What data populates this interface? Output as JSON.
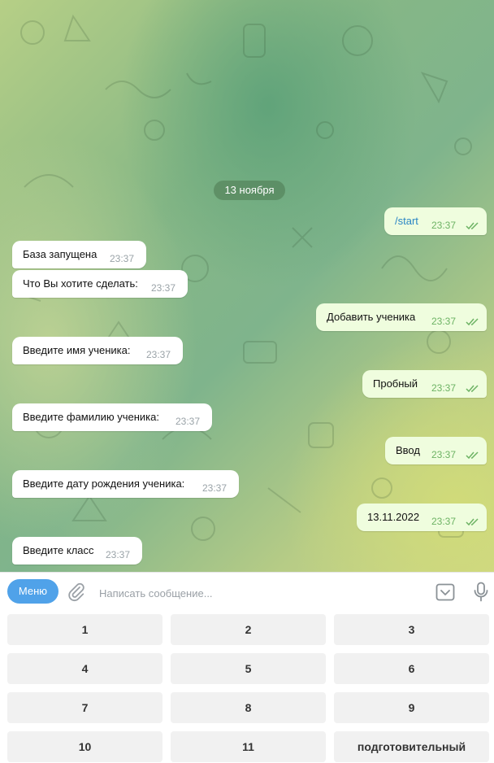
{
  "chat": {
    "date_separator": "13 ноября",
    "messages": [
      {
        "dir": "out",
        "text": "/start",
        "time": "23:37"
      },
      {
        "dir": "in",
        "text": "База запущена",
        "time": "23:37"
      },
      {
        "dir": "in",
        "text": "Что Вы хотите сделать:",
        "time": "23:37"
      },
      {
        "dir": "out",
        "text": "Добавить ученика",
        "time": "23:37"
      },
      {
        "dir": "in",
        "text": "Введите имя ученика:",
        "time": "23:37"
      },
      {
        "dir": "out",
        "text": "Пробный",
        "time": "23:37"
      },
      {
        "dir": "in",
        "text": "Введите фамилию ученика:",
        "time": "23:37"
      },
      {
        "dir": "out",
        "text": "Ввод",
        "time": "23:37"
      },
      {
        "dir": "in",
        "text": "Введите дату рождения ученика:",
        "time": "23:37"
      },
      {
        "dir": "out",
        "text": "13.11.2022",
        "time": "23:37"
      },
      {
        "dir": "in",
        "text": "Введите класс",
        "time": "23:37"
      }
    ]
  },
  "composer": {
    "menu_label": "Меню",
    "placeholder": "Написать сообщение...",
    "attach_icon": "paperclip-icon",
    "keyboard_icon": "bot-keyboard-icon",
    "mic_icon": "microphone-icon"
  },
  "keyboard": {
    "rows": [
      [
        "1",
        "2",
        "3"
      ],
      [
        "4",
        "5",
        "6"
      ],
      [
        "7",
        "8",
        "9"
      ],
      [
        "10",
        "11",
        "подготовительный"
      ]
    ]
  },
  "colors": {
    "accent": "#50a2e9",
    "outgoing_bubble": "#effdde",
    "incoming_bubble": "#ffffff",
    "read_check": "#6db364"
  }
}
